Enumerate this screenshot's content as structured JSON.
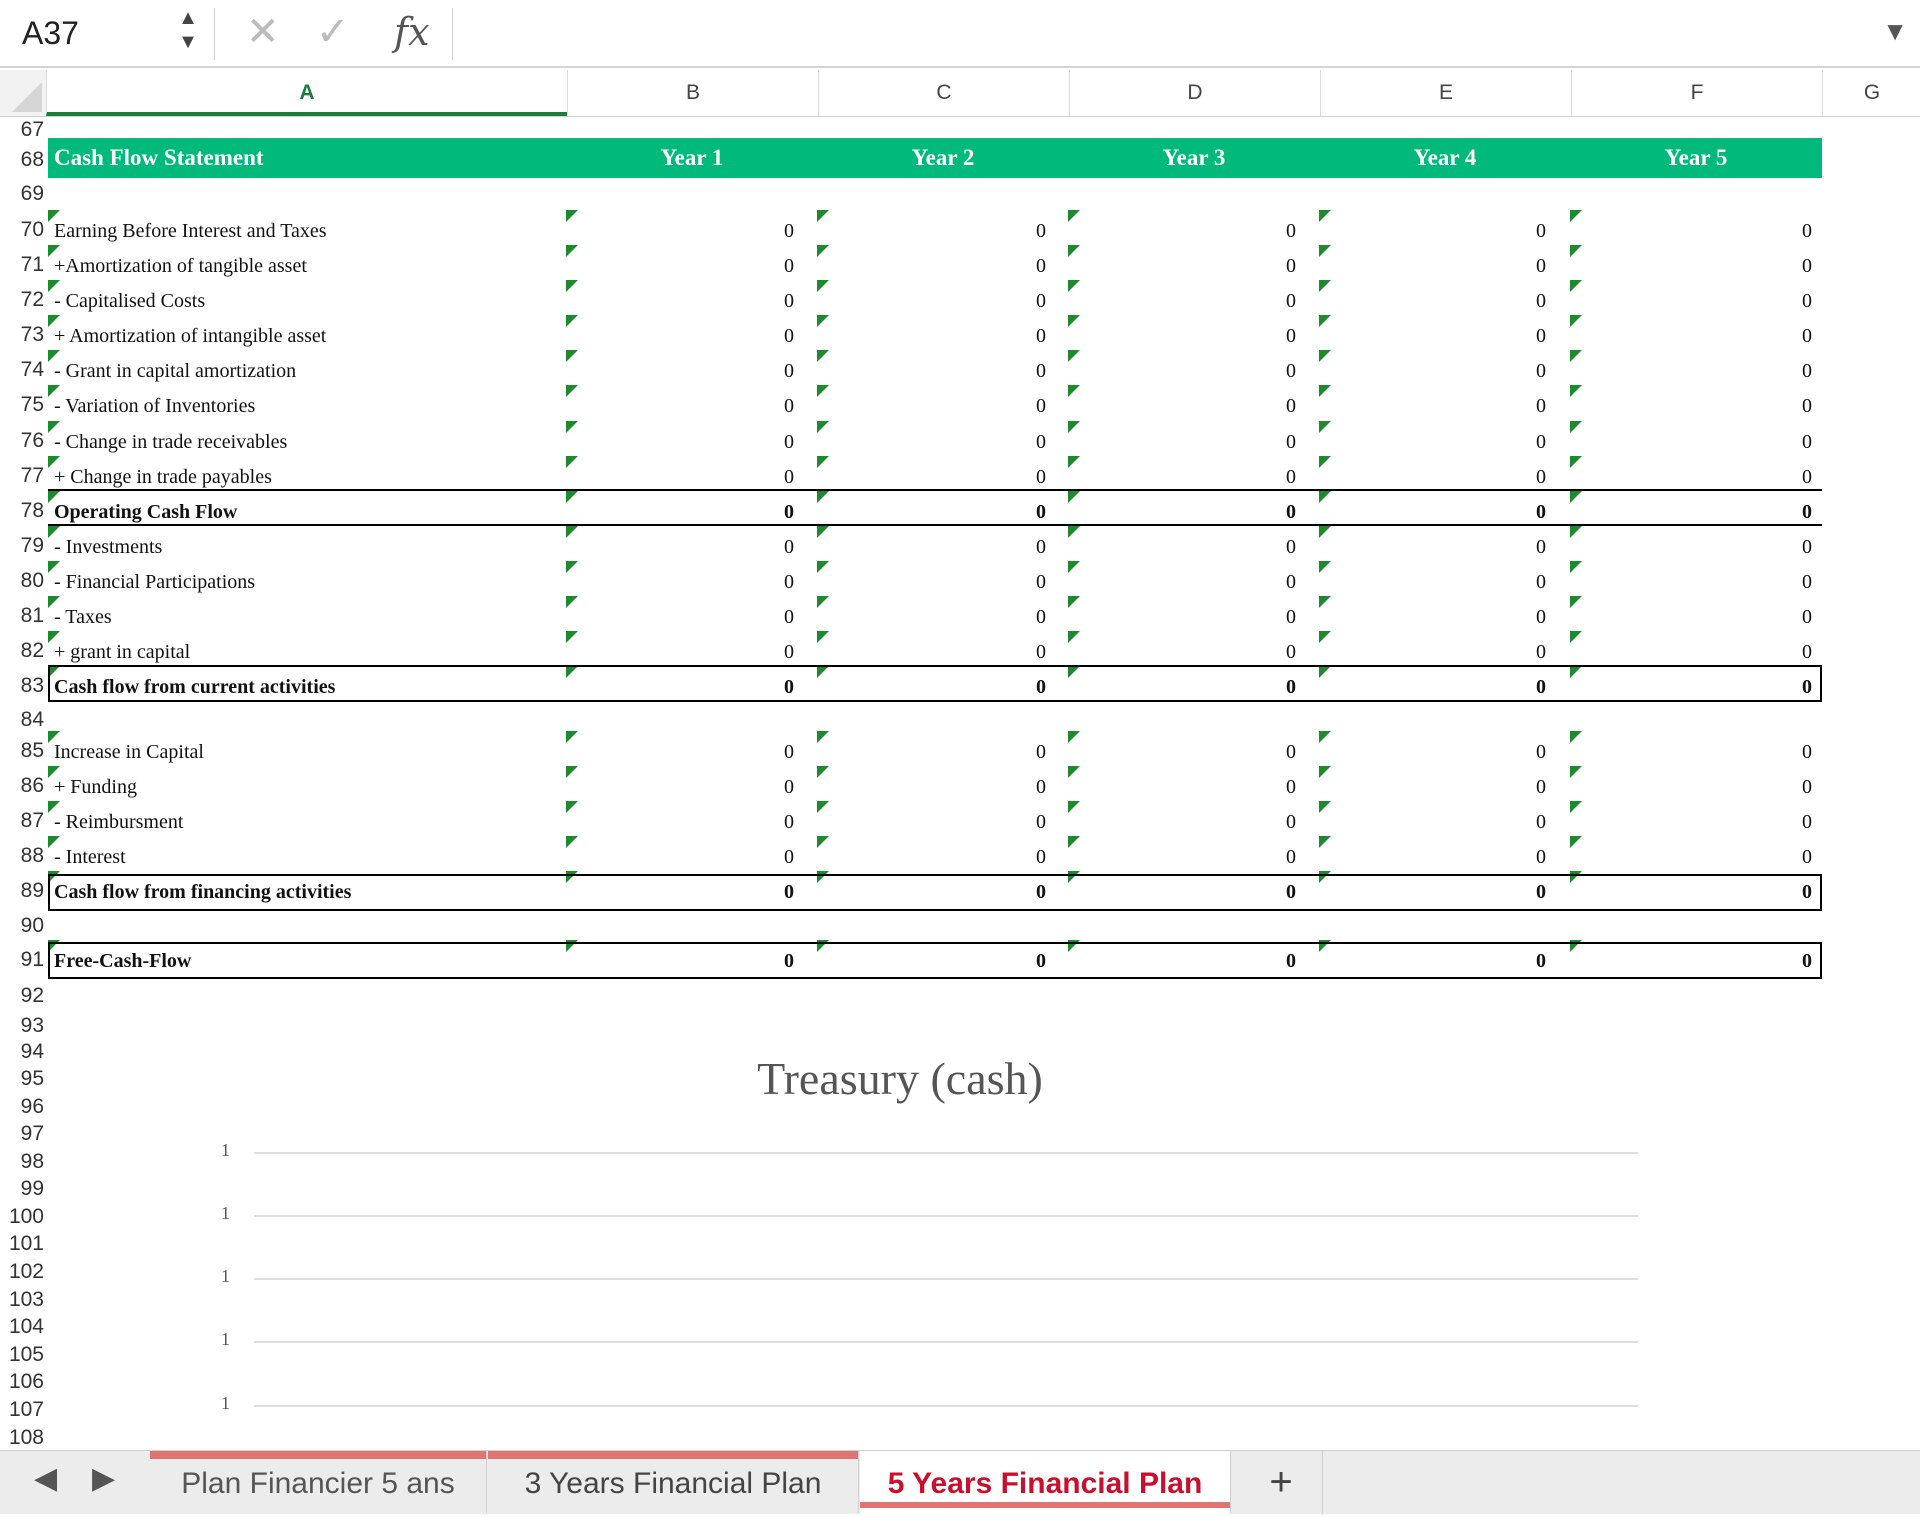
{
  "formula_bar": {
    "name_box": "A37",
    "spin_up": "▲",
    "spin_down": "▼",
    "cancel_icon": "✕",
    "confirm_icon": "✓",
    "fx_label": "fx",
    "formula": "",
    "dropdown_icon": "▼"
  },
  "columns": [
    "A",
    "B",
    "C",
    "D",
    "E",
    "F",
    "G"
  ],
  "row_numbers": [
    "67",
    "68",
    "69",
    "70",
    "71",
    "72",
    "73",
    "74",
    "75",
    "76",
    "77",
    "78",
    "79",
    "80",
    "81",
    "82",
    "83",
    "84",
    "85",
    "86",
    "87",
    "88",
    "89",
    "90",
    "91",
    "92",
    "93",
    "94",
    "95",
    "96",
    "97",
    "98",
    "99",
    "100",
    "101",
    "102",
    "103",
    "104",
    "105",
    "106",
    "107",
    "108"
  ],
  "table": {
    "header": {
      "title": "Cash Flow Statement",
      "years": [
        "Year 1",
        "Year 2",
        "Year 3",
        "Year 4",
        "Year 5"
      ]
    },
    "rows": [
      {
        "label": "Earning Before Interest and Taxes",
        "values": [
          "0",
          "0",
          "0",
          "0",
          "0"
        ]
      },
      {
        "label": "+Amortization of tangible asset",
        "values": [
          "0",
          "0",
          "0",
          "0",
          "0"
        ]
      },
      {
        "label": "- Capitalised Costs",
        "values": [
          "0",
          "0",
          "0",
          "0",
          "0"
        ]
      },
      {
        "label": "+ Amortization of intangible asset",
        "values": [
          "0",
          "0",
          "0",
          "0",
          "0"
        ]
      },
      {
        "label": "- Grant in capital amortization",
        "values": [
          "0",
          "0",
          "0",
          "0",
          "0"
        ]
      },
      {
        "label": "- Variation of Inventories",
        "values": [
          "0",
          "0",
          "0",
          "0",
          "0"
        ]
      },
      {
        "label": "- Change in trade receivables",
        "values": [
          "0",
          "0",
          "0",
          "0",
          "0"
        ]
      },
      {
        "label": "+ Change in trade payables",
        "values": [
          "0",
          "0",
          "0",
          "0",
          "0"
        ]
      },
      {
        "label": "Operating Cash Flow",
        "values": [
          "0",
          "0",
          "0",
          "0",
          "0"
        ]
      },
      {
        "label": "- Investments",
        "values": [
          "0",
          "0",
          "0",
          "0",
          "0"
        ]
      },
      {
        "label": "- Financial Participations",
        "values": [
          "0",
          "0",
          "0",
          "0",
          "0"
        ]
      },
      {
        "label": "- Taxes",
        "values": [
          "0",
          "0",
          "0",
          "0",
          "0"
        ]
      },
      {
        "label": "+ grant in capital",
        "values": [
          "0",
          "0",
          "0",
          "0",
          "0"
        ]
      },
      {
        "label": "Cash flow from current activities",
        "values": [
          "0",
          "0",
          "0",
          "0",
          "0"
        ]
      },
      {
        "label": "Increase in Capital",
        "values": [
          "0",
          "0",
          "0",
          "0",
          "0"
        ]
      },
      {
        "label": "+ Funding",
        "values": [
          "0",
          "0",
          "0",
          "0",
          "0"
        ]
      },
      {
        "label": "- Reimbursment",
        "values": [
          "0",
          "0",
          "0",
          "0",
          "0"
        ]
      },
      {
        "label": "- Interest",
        "values": [
          "0",
          "0",
          "0",
          "0",
          "0"
        ]
      },
      {
        "label": "Cash flow from financing activities",
        "values": [
          "0",
          "0",
          "0",
          "0",
          "0"
        ]
      },
      {
        "label": "Free-Cash-Flow",
        "values": [
          "0",
          "0",
          "0",
          "0",
          "0"
        ]
      }
    ]
  },
  "chart_data": {
    "type": "line",
    "title": "Treasury (cash)",
    "y_tick_labels": [
      "1",
      "1",
      "1",
      "1",
      "1"
    ],
    "series": [],
    "grid": true
  },
  "sheet_tabs": {
    "prev_icon": "◀",
    "next_icon": "▶",
    "tabs": [
      "Plan Financier 5 ans",
      "3 Years Financial Plan",
      "5 Years Financial Plan"
    ],
    "active": "5 Years Financial Plan",
    "add_icon": "+"
  },
  "colors": {
    "header_green": "#00b97a",
    "active_tab_red": "#c8102e",
    "comment_marker": "#1e8a2e"
  }
}
